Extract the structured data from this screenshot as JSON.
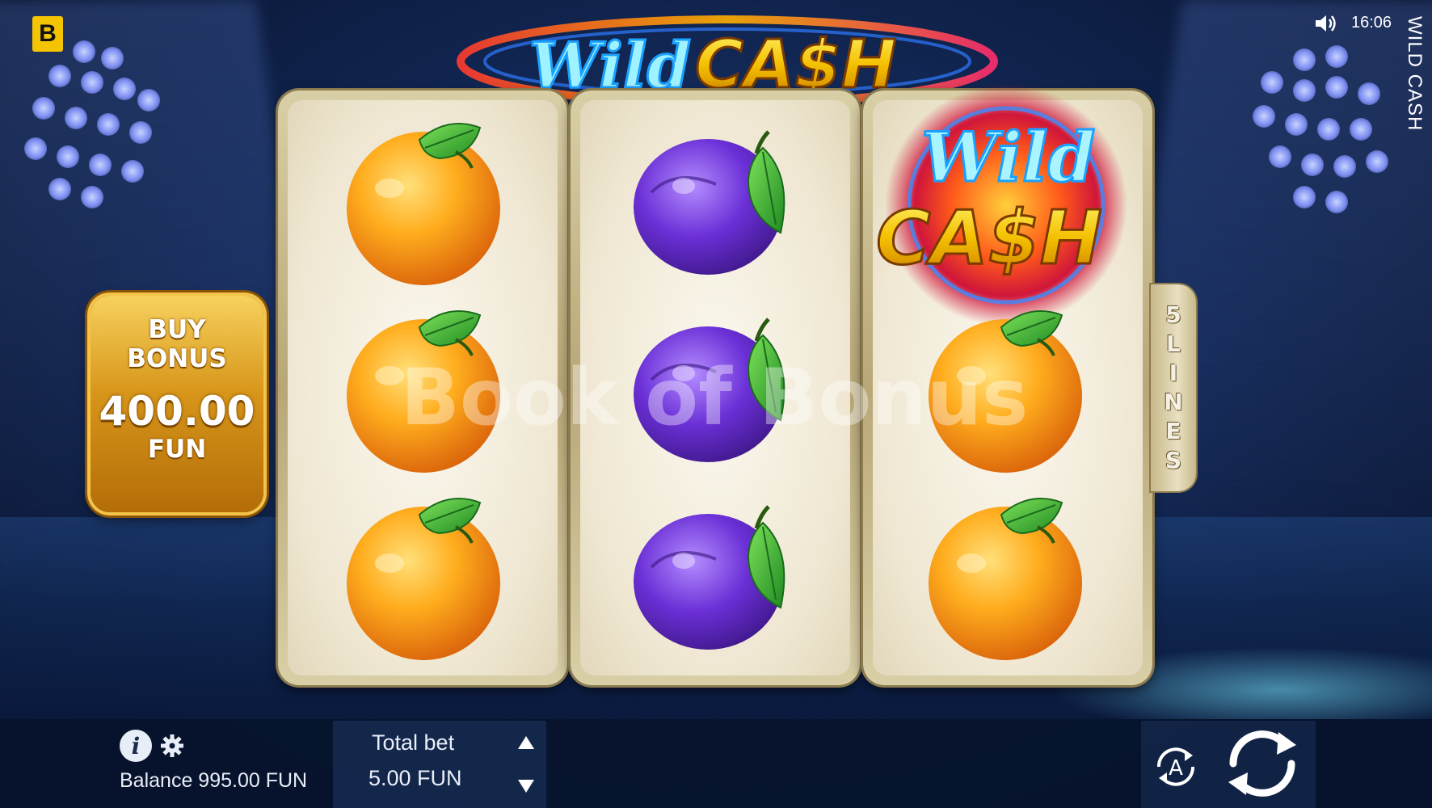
{
  "app": {
    "brand_letter": "B",
    "clock": "16:06",
    "side_title": "WILD CASH"
  },
  "title_logo": {
    "word1": "Wild",
    "word2": "CA$H"
  },
  "reels": [
    {
      "symbols": [
        "orange",
        "orange",
        "orange"
      ]
    },
    {
      "symbols": [
        "plum",
        "plum",
        "plum"
      ]
    },
    {
      "symbols": [
        "wild-cash",
        "orange",
        "orange"
      ]
    }
  ],
  "wild_symbol": {
    "word1": "Wild",
    "word2": "CA$H"
  },
  "lines_tab": {
    "chars": [
      "5",
      "L",
      "I",
      "N",
      "E",
      "S"
    ]
  },
  "buy_bonus": {
    "line1": "BUY",
    "line2": "BONUS",
    "amount": "400.00",
    "currency": "FUN"
  },
  "watermark": "Book of Bonus",
  "bottom": {
    "balance": "Balance 995.00 FUN",
    "bet_label": "Total bet",
    "bet_value": "5.00 FUN",
    "info_label": "i",
    "autoplay_letter": "A"
  },
  "colors": {
    "gold": "#f5c400",
    "reel_frame": "#b9a777",
    "background": "#10244f"
  },
  "icons": [
    "sound-icon",
    "info-icon",
    "gear-icon",
    "arrow-up-icon",
    "arrow-down-icon",
    "autoplay-icon",
    "spin-icon"
  ]
}
